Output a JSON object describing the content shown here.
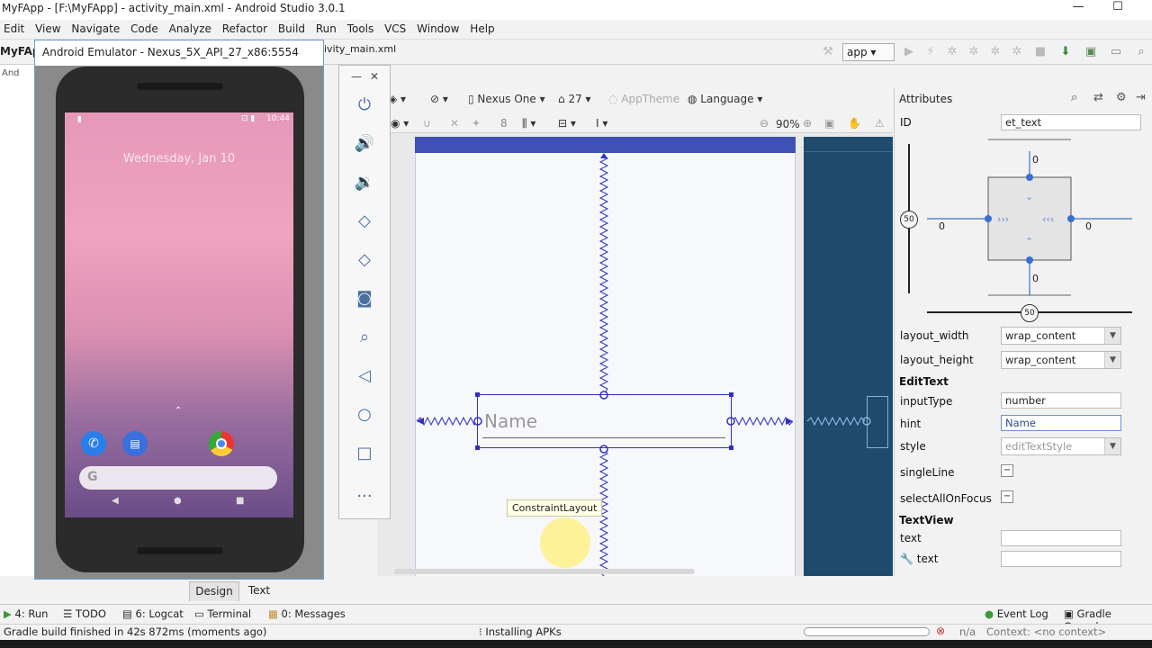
{
  "window": {
    "title": "MyFApp - [F:\\MyFApp] - activity_main.xml - Android Studio 3.0.1",
    "minimize": "—",
    "maximize": "☐"
  },
  "menu": [
    "Edit",
    "View",
    "Navigate",
    "Code",
    "Analyze",
    "Refactor",
    "Build",
    "Run",
    "Tools",
    "VCS",
    "Window",
    "Help"
  ],
  "toolbar": {
    "run_config": "app"
  },
  "project": {
    "label": "MyFApp",
    "side_label": "And"
  },
  "editor": {
    "tab_label": "ivity_main.xml"
  },
  "design_toolbar": {
    "device": "Nexus One",
    "api": "27",
    "theme": "AppTheme",
    "language": "Language",
    "zoom": "90%",
    "margin_value": "8"
  },
  "canvas": {
    "edittext_hint": "Name",
    "tooltip": "ConstraintLayout"
  },
  "emulator": {
    "title": "Android Emulator - Nexus_5X_API_27_x86:5554",
    "time": "10:44",
    "date": "Wednesday, Jan 10",
    "search_glyph": "G",
    "sidebar_close": "✕",
    "sidebar_min": "—",
    "more": "..."
  },
  "attributes": {
    "header": "Attributes",
    "id_label": "ID",
    "id_value": "et_text",
    "constraint_values": {
      "top": "0",
      "bottom": "0",
      "left": "0",
      "right": "0",
      "vertical_bias": "50",
      "horizontal_bias": "50"
    },
    "layout_width_label": "layout_width",
    "layout_width_value": "wrap_content",
    "layout_height_label": "layout_height",
    "layout_height_value": "wrap_content",
    "section_edittext": "EditText",
    "input_type_label": "inputType",
    "input_type_value": "number",
    "hint_label": "hint",
    "hint_value": "Name",
    "style_label": "style",
    "style_value": "editTextStyle",
    "single_line_label": "singleLine",
    "select_all_label": "selectAllOnFocus",
    "section_textview": "TextView",
    "text_label": "text",
    "text_label_tools": "text"
  },
  "bottom_tabs": {
    "design": "Design",
    "text": "Text"
  },
  "tool_windows": {
    "run": "4: Run",
    "todo": "TODO",
    "logcat": "6: Logcat",
    "terminal": "Terminal",
    "messages": "0: Messages",
    "event_log": "Event Log",
    "gradle_console": "Gradle Console"
  },
  "status": {
    "message": "Gradle build finished in 42s 872ms (moments ago)",
    "installing": "Installing APKs",
    "na": "n/a",
    "context": "Context: <no context>"
  },
  "colors": {
    "accent": "#3f51b5",
    "blueprint": "#1e4a6e",
    "constraint": "#3030c0"
  }
}
